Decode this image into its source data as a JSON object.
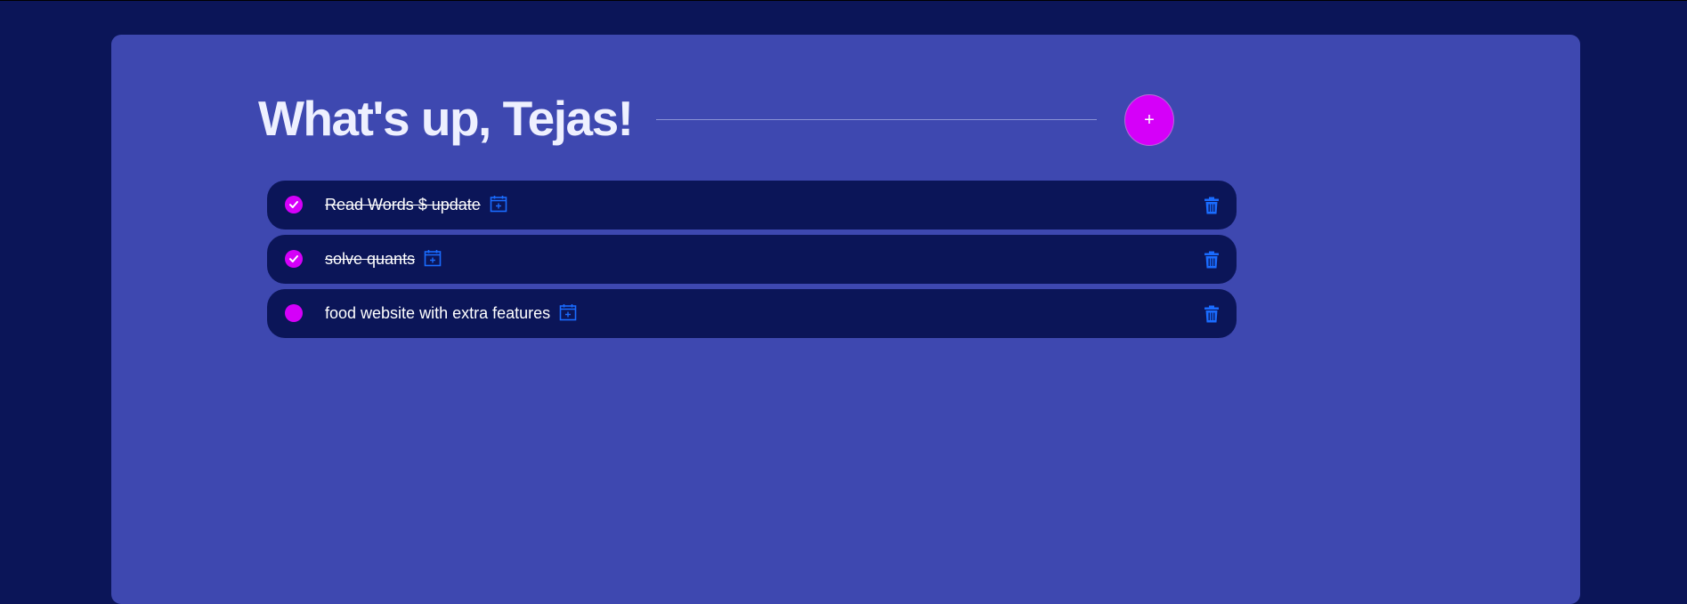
{
  "header": {
    "title": "What's up, Tejas!",
    "add_button_label": "+"
  },
  "tasks": [
    {
      "text": "Read Words $ update",
      "completed": true
    },
    {
      "text": "solve quants",
      "completed": true
    },
    {
      "text": "food website with extra features",
      "completed": false
    }
  ],
  "colors": {
    "page_background": "#0b1558",
    "panel_background": "#3e48b0",
    "accent": "#d500f9",
    "icon_blue": "#1a6cff",
    "task_background": "#0b1558"
  },
  "icons": {
    "check": "check-icon",
    "calendar": "calendar-plus-icon",
    "delete": "trash-icon"
  }
}
